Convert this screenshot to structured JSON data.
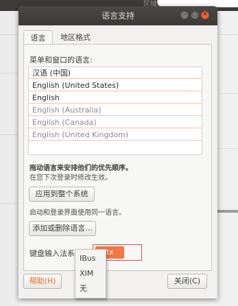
{
  "background": {
    "top_text": "区域",
    "tooltip": ""
  },
  "window": {
    "title": "语言支持",
    "min_glyph": "–",
    "max_glyph": "□",
    "close_glyph": "×"
  },
  "tabs": [
    {
      "label": "语言",
      "active": true
    },
    {
      "label": "地区格式",
      "active": false
    }
  ],
  "language_section": {
    "heading": "菜单和窗口的语言:",
    "languages": [
      {
        "label": "汉语 (中国)",
        "state": "active"
      },
      {
        "label": "English (United States)",
        "state": "active"
      },
      {
        "label": "English",
        "state": "active"
      },
      {
        "label": "English (Australia)",
        "state": "inactive"
      },
      {
        "label": "English (Canada)",
        "state": "inactive"
      },
      {
        "label": "English (United Kingdom)",
        "state": "inactive"
      },
      {
        "label": "",
        "state": "empty"
      }
    ],
    "drag_hint": "拖动语言来安排他们的优先顺序。",
    "next_login_hint": "在您下次登录时修改生效。",
    "apply_button": "应用到整个系统",
    "startup_hint": "启动和登录界面使用同一语言。",
    "install_button": "添加或删除语言..."
  },
  "input_method": {
    "label": "键盘输入法系统:",
    "selected": "fcitx",
    "options": [
      "IBus",
      "XIM",
      "无"
    ]
  },
  "footer": {
    "help_button": "帮助(H)",
    "close_button": "关闭(C)"
  },
  "colors": {
    "accent": "#f07746",
    "close_button": "#f0613a",
    "titlebar": "#3c3b37",
    "highlight_border": "#e04848"
  }
}
